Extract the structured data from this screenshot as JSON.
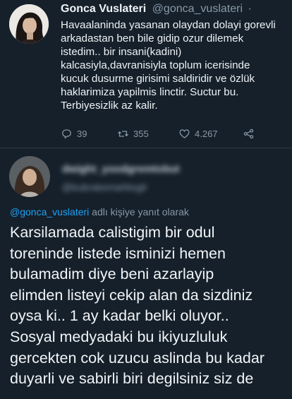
{
  "tweet": {
    "author_name": "Gonca Vuslateri",
    "author_handle": "@gonca_vuslateri",
    "separator": "·",
    "lines": [
      "Havaalaninda yasanan olaydan dolayi gorevli",
      "arkadastan ben bile gidip ozur dilemek",
      "istedim.. bir insani(kadini)",
      "kalcasiyla,davranisiyla toplum icerisinde",
      "kucuk dusurme girisimi saldiridir ve özlük",
      "haklarimiza yapilmis linctir. Suctur bu.",
      "Terbiyesizlik az kalir."
    ],
    "actions": {
      "reply_count": "39",
      "retweet_count": "355",
      "like_count": "4.267"
    },
    "icons": [
      "reply-icon",
      "retweet-icon",
      "like-icon",
      "share-icon"
    ]
  },
  "reply": {
    "author_name_blurred": "dwight_yoodgremtobut",
    "author_handle_blurred": "@kubrakemahlioglr",
    "replying_to_mention": "@gonca_vuslateri",
    "replying_to_suffix": " adlı kişiye yanıt olarak",
    "lines": [
      "Karsilamada calistigim bir odul",
      "toreninde listede isminizi hemen",
      "bulamadim diye beni azarlayip",
      "elimden listeyi cekip alan da sizdiniz",
      "oysa ki.. 1 ay kadar belki oluyor..",
      "Sosyal medyadaki bu ikiyuzluluk",
      "gercekten cok uzucu aslinda bu kadar",
      "duyarli ve sabirli biri degilsiniz siz de"
    ]
  },
  "colors": {
    "background": "#15202b",
    "secondary_text": "#8899a6",
    "mention": "#1da1f2"
  }
}
